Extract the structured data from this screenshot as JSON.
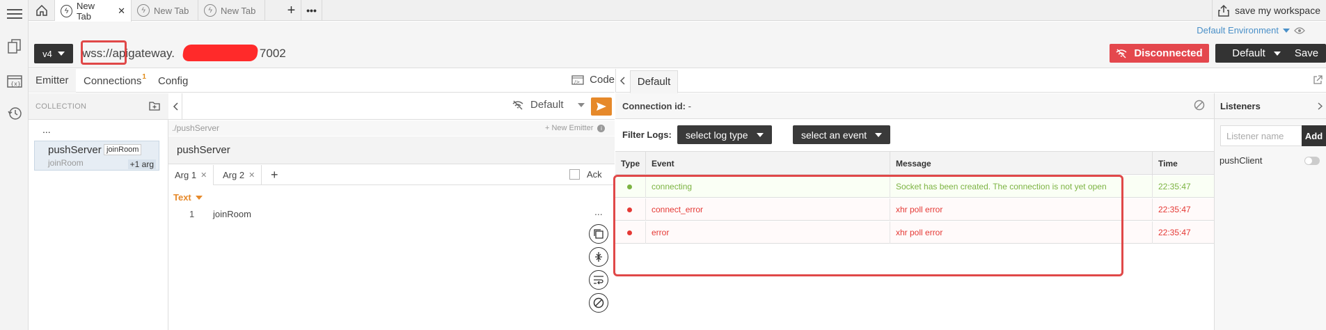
{
  "tabs": [
    {
      "label": "New Tab",
      "active": true
    },
    {
      "label": "New Tab",
      "active": false
    },
    {
      "label": "New Tab",
      "active": false
    }
  ],
  "workspace": {
    "save_label": "save my workspace"
  },
  "environment": {
    "label": "Default Environment"
  },
  "url_bar": {
    "version": "v4",
    "url_prefix": "wss://apigateway.",
    "url_suffix": "7002"
  },
  "status": {
    "label": "Disconnected",
    "color": "#e4474d"
  },
  "env_button": {
    "label": "Default"
  },
  "save_button": {
    "label": "Save"
  },
  "left_tabs": [
    {
      "label": "Emitter",
      "active": true
    },
    {
      "label": "Connections",
      "badge": "1"
    },
    {
      "label": "Config"
    }
  ],
  "code_label": "Code",
  "collection": {
    "header": "COLLECTION",
    "ellipsis": "...",
    "item": {
      "name": "pushServer",
      "tag": "joinRoom",
      "sub": "joinRoom",
      "args": "+1 arg"
    }
  },
  "editor": {
    "env_label": "Default",
    "path": "./pushServer",
    "new_emitter": "+ New Emitter",
    "emitter_name": "pushServer",
    "arg_tabs": [
      "Arg 1",
      "Arg 2"
    ],
    "ack_label": "Ack",
    "type_label": "Text",
    "line_number": "1",
    "line_value": "joinRoom",
    "more": "..."
  },
  "right_panel": {
    "tab_label": "Default",
    "connection_label": "Connection id:",
    "connection_value": "-",
    "filter_label": "Filter Logs:",
    "log_type_dd": "select log type",
    "event_dd": "select an event",
    "columns": [
      "Type",
      "Event",
      "Message",
      "Time"
    ],
    "rows": [
      {
        "event": "connecting",
        "message": "Socket has been created. The connection is not yet open",
        "time": "22:35:47",
        "color": "#7cb342"
      },
      {
        "event": "connect_error",
        "message": "xhr poll error",
        "time": "22:35:47",
        "color": "#e53935"
      },
      {
        "event": "error",
        "message": "xhr poll error",
        "time": "22:35:47",
        "color": "#e53935"
      }
    ]
  },
  "listeners": {
    "header": "Listeners",
    "input_placeholder": "Listener name",
    "add_label": "Add",
    "items": [
      "pushClient"
    ]
  }
}
